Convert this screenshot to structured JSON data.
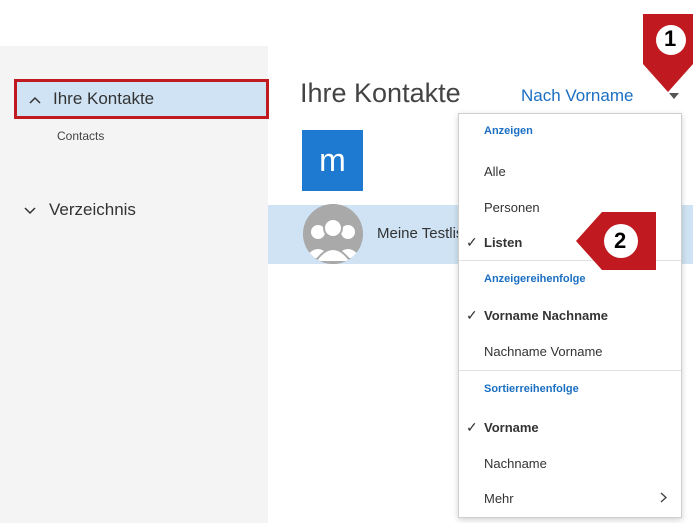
{
  "sidebar": {
    "contacts_label": "Ihre Kontakte",
    "contacts_sub": "Contacts",
    "directory_label": "Verzeichnis"
  },
  "main": {
    "title": "Ihre Kontakte",
    "sort_label": "Nach Vorname",
    "letter": "m",
    "contact_name": "Meine Testliste"
  },
  "menu": {
    "anzeigen_head": "Anzeigen",
    "alle": "Alle",
    "personen": "Personen",
    "listen": "Listen",
    "reihenfolge_head": "Anzeigereihenfolge",
    "vorname_nachname": "Vorname Nachname",
    "nachname_vorname": "Nachname Vorname",
    "sortierreihenfolge_head": "Sortierreihenfolge",
    "vorname": "Vorname",
    "nachname": "Nachname",
    "mehr": "Mehr",
    "checkmark": "✓"
  },
  "callouts": {
    "one": "1",
    "two": "2"
  },
  "colors": {
    "accent": "#1a6fc2",
    "highlight": "#cfe3f4",
    "callout_red": "#c0191f"
  }
}
